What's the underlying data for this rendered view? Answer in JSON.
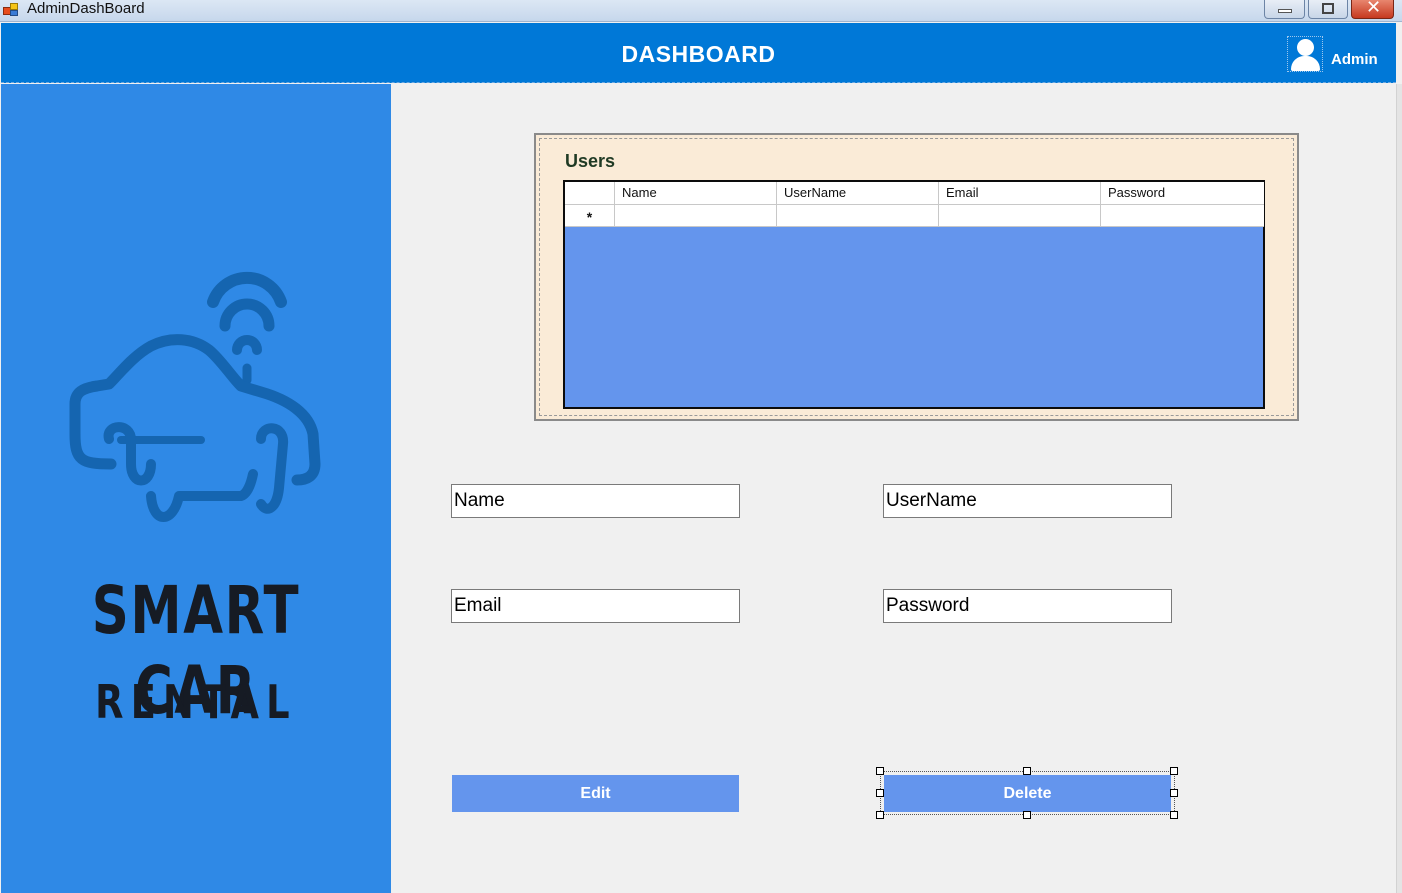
{
  "window": {
    "title": "AdminDashBoard",
    "close_glyph": "✕",
    "buttons": [
      "minimize",
      "maximize",
      "close"
    ]
  },
  "header": {
    "title": "DASHBOARD",
    "user_label": "Admin",
    "background": "#0078d7"
  },
  "sidebar": {
    "brand_main": "SMART CAR",
    "brand_sub": "RENTAL",
    "background": "#2f89e6",
    "logo_color": "#1565b0"
  },
  "users_panel": {
    "title": "Users",
    "columns": [
      "Name",
      "UserName",
      "Email",
      "Password"
    ],
    "new_row_marker": "*",
    "rows": [],
    "background": "#faebd7",
    "grid_background": "#6495ed"
  },
  "form": {
    "name_value": "Name",
    "username_value": "UserName",
    "email_value": "Email",
    "password_value": "Password"
  },
  "actions": {
    "edit_label": "Edit",
    "delete_label": "Delete",
    "button_color": "#6495ed"
  }
}
